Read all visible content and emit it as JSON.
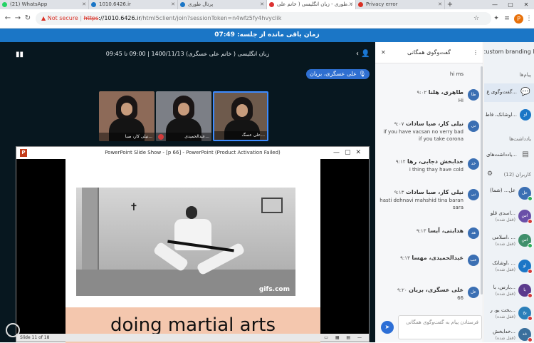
{
  "browser": {
    "tabs": [
      {
        "label": "(21) WhatsApp",
        "color": "#25d366",
        "active": false
      },
      {
        "label": "1010.6426.ir",
        "color": "#1b76c6",
        "active": false
      },
      {
        "label": "پرتال طوری",
        "color": "#1b76c6",
        "active": false
      },
      {
        "label": "طوری - زبان انگلیسی ( خانم علی...",
        "color": "#d33",
        "active": true
      },
      {
        "label": "Privacy error",
        "color": "#d93025",
        "active": false
      }
    ],
    "address": {
      "warning": "Not secure",
      "scheme": "https",
      "host": "://1010.6426.ir",
      "path": "/html5client/join?sessionToken=n4wfz5fy4hvyclik"
    },
    "profile_initial": "P"
  },
  "session_bar": {
    "text": "زمان باقی مانده از جلسه: 07:49"
  },
  "meeting": {
    "title": "زبان انگلیسی ( خانم علی عسگری) 1400/11/13 | 09:00 تا 09:45",
    "presenter": "علی عسگری، بریان",
    "cameras": [
      {
        "name": "علی عسگ...",
        "active": true
      },
      {
        "name": "عبدالحمیدی...",
        "active": false
      },
      {
        "name": "نیلی کار، صبا...",
        "active": false
      }
    ]
  },
  "ppt": {
    "title": "PowerPoint Slide Show - [p 66] - PowerPoint (Product Activation Failed)",
    "logo": "P",
    "caption": "doing martial arts",
    "watermark": "gifs.com",
    "status": "Slide 11 of 18"
  },
  "chat": {
    "header": "گفت‌وگوی همگانی",
    "input_placeholder": "فرستادن پیام به گفت‌وگوی همگانی",
    "messages": [
      {
        "initials": "",
        "name": "",
        "time": "",
        "text": "hi ms",
        "color": "#6e7fa8"
      },
      {
        "initials": "طا",
        "name": "طاهری، هلنا",
        "time": "۹:۰۲",
        "text": "Hi",
        "color": "#3b6fb3"
      },
      {
        "initials": "نی",
        "name": "نیلی کار، صبا سادات",
        "time": "۹:۰۷",
        "text": "if you have vacsan no verry bad if you take corona",
        "color": "#3b6fb3"
      },
      {
        "initials": "خد",
        "name": "خدابخش دجابی، رها",
        "time": "۹:۱۲",
        "text": "i thing thay have cold",
        "color": "#3b6fb3"
      },
      {
        "initials": "نی",
        "name": "نیلی کار، صبا سادات",
        "time": "۹:۱۳",
        "text": "hasti dehnavi mahshid tina baran sara",
        "color": "#3b6fb3"
      },
      {
        "initials": "هد",
        "name": "هدایتی، آیسا",
        "time": "۹:۱۳",
        "text": "",
        "color": "#3b6fb3"
      },
      {
        "initials": "عب",
        "name": "عبدالحمیدی، مهسا",
        "time": "۹:۱۳",
        "text": "",
        "color": "#3b6fb3"
      },
      {
        "initials": "عل",
        "name": "علی عسگری، بریان",
        "time": "۹:۲۰",
        "text": "66",
        "color": "#3b6fb3"
      }
    ]
  },
  "sidebar": {
    "brand": "custom branding logo",
    "messages_heading": "پیام‌ها",
    "public_chat_label": "گفت‌وگوی ع...",
    "private_chat_label": "اوشانک، فاط...",
    "notes_heading": "یادداشت‌ها",
    "shared_notes_label": "یادداشت‌های...",
    "users_heading": "کاربران (12)",
    "users": [
      {
        "initials": "عل",
        "name": "عل... (شما)",
        "status": "",
        "color": "#3b6fb3",
        "dot": "green"
      },
      {
        "initials": "اس",
        "name": "اسدی قلو...",
        "status": "(قفل شده)",
        "color": "#6a4fa8",
        "dot": "red"
      },
      {
        "initials": "اس",
        "name": "اسلامی، ...",
        "status": "(قفل شده)",
        "color": "#3f8f6b",
        "dot": "green"
      },
      {
        "initials": "او",
        "name": "اوشانک، ...",
        "status": "(قفل شده)",
        "color": "#1b76c6",
        "dot": "red"
      },
      {
        "initials": "با",
        "name": "بارس، با...",
        "status": "(قفل شده)",
        "color": "#5b3a8c",
        "dot": "red"
      },
      {
        "initials": "بخ",
        "name": "بخت یو، ر...",
        "status": "(قفل شده)",
        "color": "#2b7fb9",
        "dot": "red"
      },
      {
        "initials": "خد",
        "name": "خدابخش...",
        "status": "(قفل شده)",
        "color": "#3a6f9c",
        "dot": "red"
      }
    ]
  }
}
